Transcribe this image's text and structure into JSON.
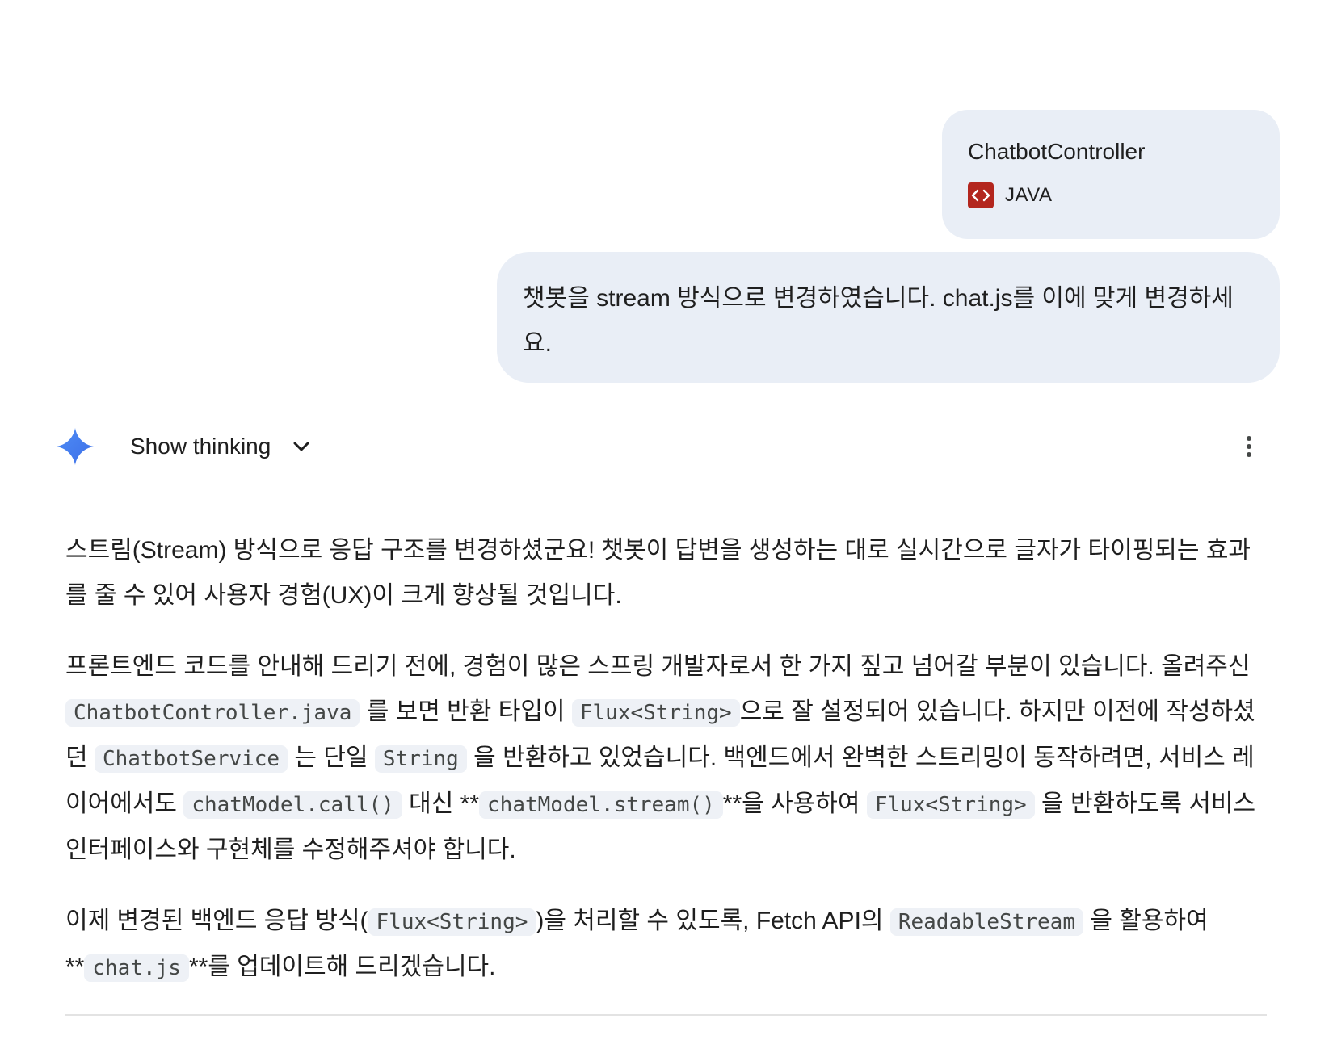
{
  "attachment": {
    "file_name": "ChatbotController",
    "file_type": "JAVA",
    "icon": "code-file-icon",
    "icon_color": "#b3261e"
  },
  "user_message": {
    "text": "챗봇을 stream 방식으로 변경하였습니다. chat.js를 이에 맞게 변경하세요."
  },
  "response_header": {
    "show_thinking_label": "Show thinking",
    "gem_icon": "gemini-spark-icon",
    "more_icon": "more-vert-icon"
  },
  "response": {
    "p1": {
      "text": "스트림(Stream) 방식으로 응답 구조를 변경하셨군요! 챗봇이 답변을 생성하는 대로 실시간으로 글자가 타이핑되는 효과를 줄 수 있어 사용자 경험(UX)이 크게 향상될 것입니다."
    },
    "p2": {
      "t1": "프론트엔드 코드를 안내해 드리기 전에, 경험이 많은 스프링 개발자로서 한 가지 짚고 넘어갈 부분이 있습니다. 올려주신 ",
      "c1": "ChatbotController.java",
      "t2": " 를 보면 반환 타입이 ",
      "c2": "Flux<String>",
      "t3": "으로 잘 설정되어 있습니다. 하지만 이전에 작성하셨던 ",
      "c3": "ChatbotService",
      "t4": " 는 단일 ",
      "c4": "String",
      "t5": " 을 반환하고 있었습니다. 백엔드에서 완벽한 스트리밍이 동작하려면, 서비스 레이어에서도 ",
      "c5": "chatModel.call()",
      "t6": " 대신 **",
      "c6": "chatModel.stream()",
      "t7": "**을 사용하여 ",
      "c7": "Flux<String>",
      "t8": " 을 반환하도록 서비스 인터페이스와 구현체를 수정해주셔야 합니다."
    },
    "p3": {
      "t1": "이제 변경된 백엔드 응답 방식(",
      "c1": "Flux<String>",
      "t2": ")을 처리할 수 있도록, Fetch API의 ",
      "c2": "ReadableStream",
      "t3": " 을 활용하여 **",
      "c3": "chat.js",
      "t4": "**를 업데이트해 드리겠습니다."
    }
  }
}
